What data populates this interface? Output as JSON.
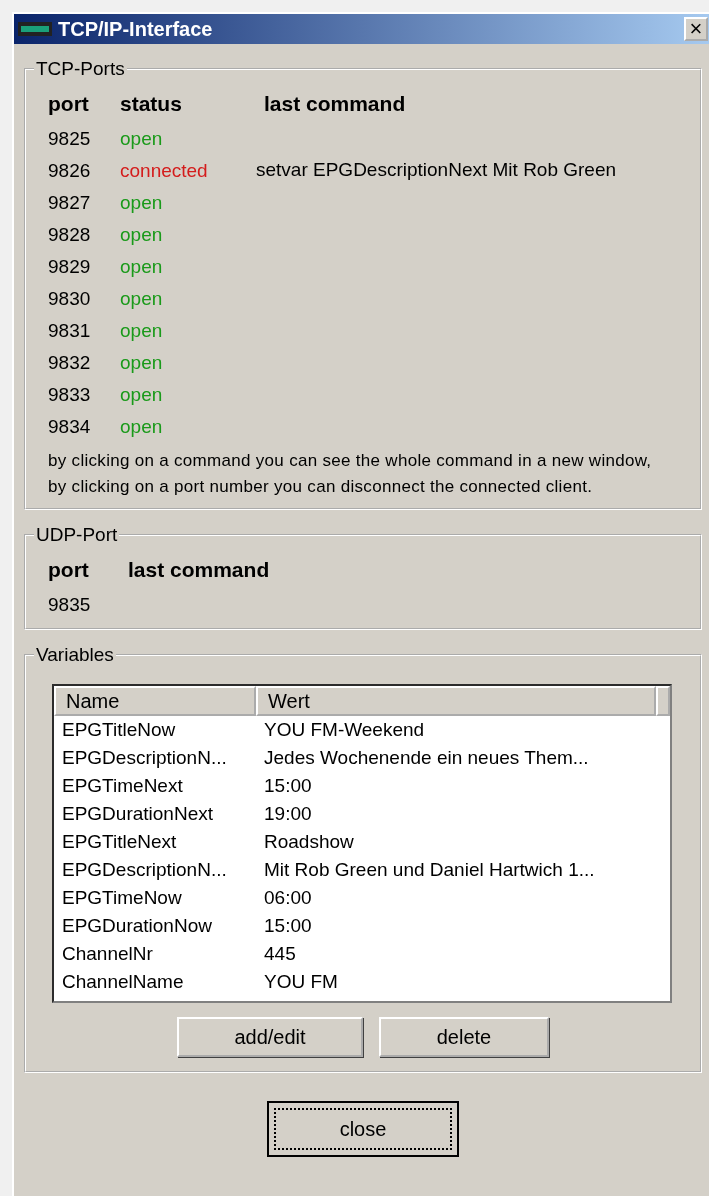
{
  "window": {
    "title": "TCP/IP-Interface",
    "close": "×"
  },
  "tcp_ports": {
    "title": "TCP-Ports",
    "columns": [
      "port",
      "status",
      "last command"
    ],
    "rows": [
      {
        "port": "9825",
        "status": "open",
        "color": "#1a9a1a"
      },
      {
        "port": "9826",
        "status": "connected",
        "color": "#d41c1c",
        "last_command": "setvar EPGDescriptionNext Mit Rob Green"
      },
      {
        "port": "9827",
        "status": "open",
        "color": "#1a9a1a"
      },
      {
        "port": "9828",
        "status": "open",
        "color": "#1a9a1a"
      },
      {
        "port": "9829",
        "status": "open",
        "color": "#1a9a1a"
      },
      {
        "port": "9830",
        "status": "open",
        "color": "#1a9a1a"
      },
      {
        "port": "9831",
        "status": "open",
        "color": "#1a9a1a"
      },
      {
        "port": "9832",
        "status": "open",
        "color": "#1a9a1a"
      },
      {
        "port": "9833",
        "status": "open",
        "color": "#1a9a1a"
      },
      {
        "port": "9834",
        "status": "open",
        "color": "#1a9a1a"
      }
    ],
    "hint": [
      "by clicking on a command you can see the whole command in a new window,",
      "by clicking on a port number you can disconnect the connected client."
    ]
  },
  "udp_port": {
    "title": "UDP-Port",
    "columns": [
      "port",
      "last command"
    ],
    "rows": [
      {
        "port": "9835"
      }
    ]
  },
  "variables": {
    "title": "Variables",
    "columns": [
      "Name",
      "Wert"
    ],
    "rows": [
      {
        "name": "EPGTitleNow",
        "value": "YOU FM-Weekend"
      },
      {
        "name": "EPGDescriptionN...",
        "value": "Jedes Wochenende ein neues Them..."
      },
      {
        "name": "EPGTimeNext",
        "value": "15:00"
      },
      {
        "name": "EPGDurationNext",
        "value": "19:00"
      },
      {
        "name": "EPGTitleNext",
        "value": "Roadshow"
      },
      {
        "name": "EPGDescriptionN...",
        "value": "Mit Rob Green und Daniel Hartwich 1..."
      },
      {
        "name": "EPGTimeNow",
        "value": "06:00"
      },
      {
        "name": "EPGDurationNow",
        "value": "15:00"
      },
      {
        "name": "ChannelNr",
        "value": "445"
      },
      {
        "name": "ChannelName",
        "value": "YOU FM"
      }
    ],
    "buttons": [
      "add/edit",
      "delete"
    ]
  },
  "buttons": [
    "close"
  ]
}
